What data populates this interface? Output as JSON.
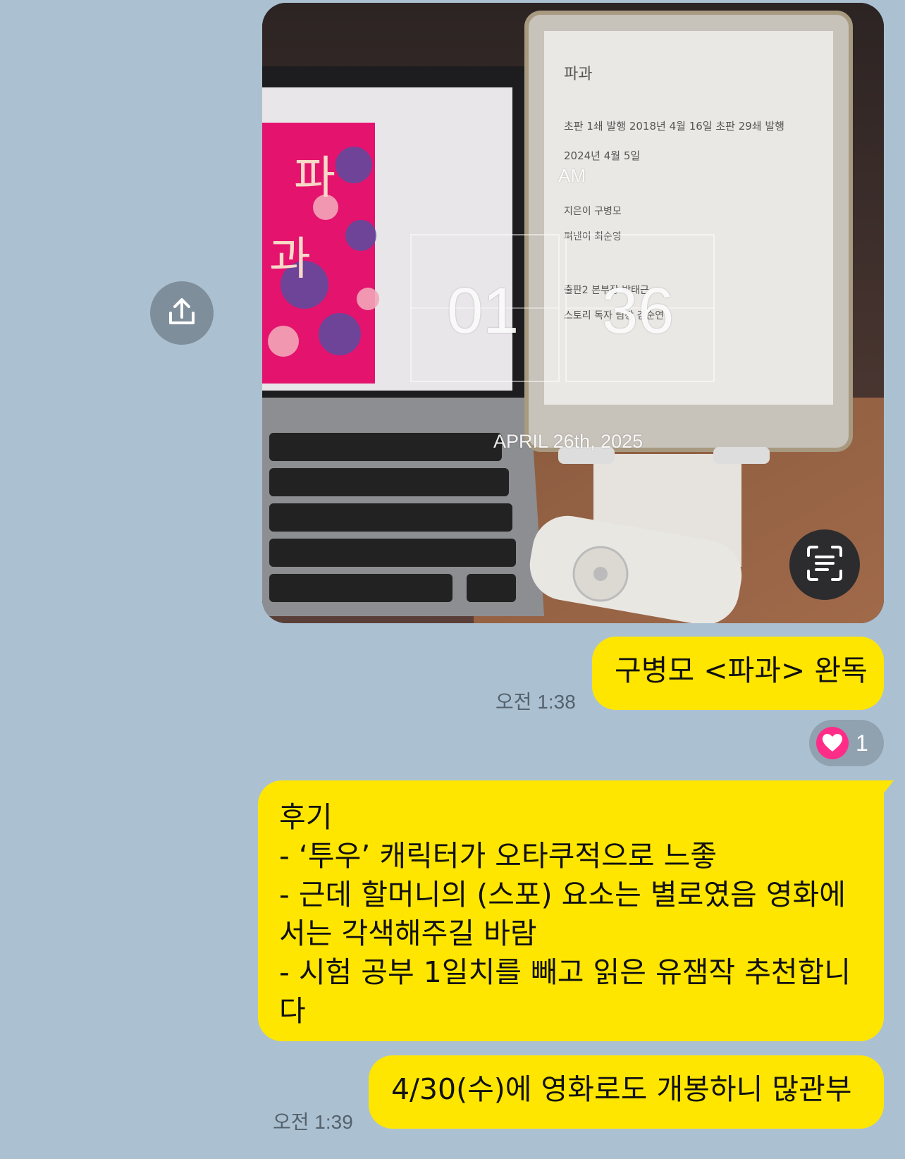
{
  "photo": {
    "clock": {
      "meridiem": "AM",
      "hour": "01",
      "minute": "36",
      "date": "APRIL 26th, 2025"
    },
    "ereader_page": {
      "title": "파과",
      "edition_line_1": "초판 1쇄 발행 2018년 4월 16일 초판 29쇄 발행",
      "edition_line_2": "2024년 4월 5일",
      "author_line": "지은이 구병모",
      "publisher_line": "펴낸이 최순영",
      "credit_line_1": "출판2 본부장 박태근",
      "credit_line_2": "스토리 독자 팀장 김순연"
    },
    "book_cover": {
      "title_char_1": "파",
      "title_char_2": "과"
    }
  },
  "messages": [
    {
      "text": "구병모 <파과> 완독",
      "time": "오전 1:38"
    },
    {
      "lines": [
        "후기",
        "- ‘투우’ 캐릭터가 오타쿠적으로 느좋",
        "- 근데 할머니의 (스포) 요소는 별로였음 영화에",
        "서는 각색해주길 바람",
        "- 시험 공부 1일치를 빼고 읽은 유잼작 추천합니",
        "다"
      ]
    },
    {
      "text": "4/30(수)에 영화로도 개봉하니 많관부",
      "time": "오전 1:39"
    }
  ],
  "reaction": {
    "icon": "heart-icon",
    "count": "1",
    "color": "#ff2d87"
  },
  "icons": {
    "share": "share-icon",
    "scan": "text-scan-icon"
  },
  "colors": {
    "background": "#abc1d2",
    "bubble": "#ffe600"
  }
}
